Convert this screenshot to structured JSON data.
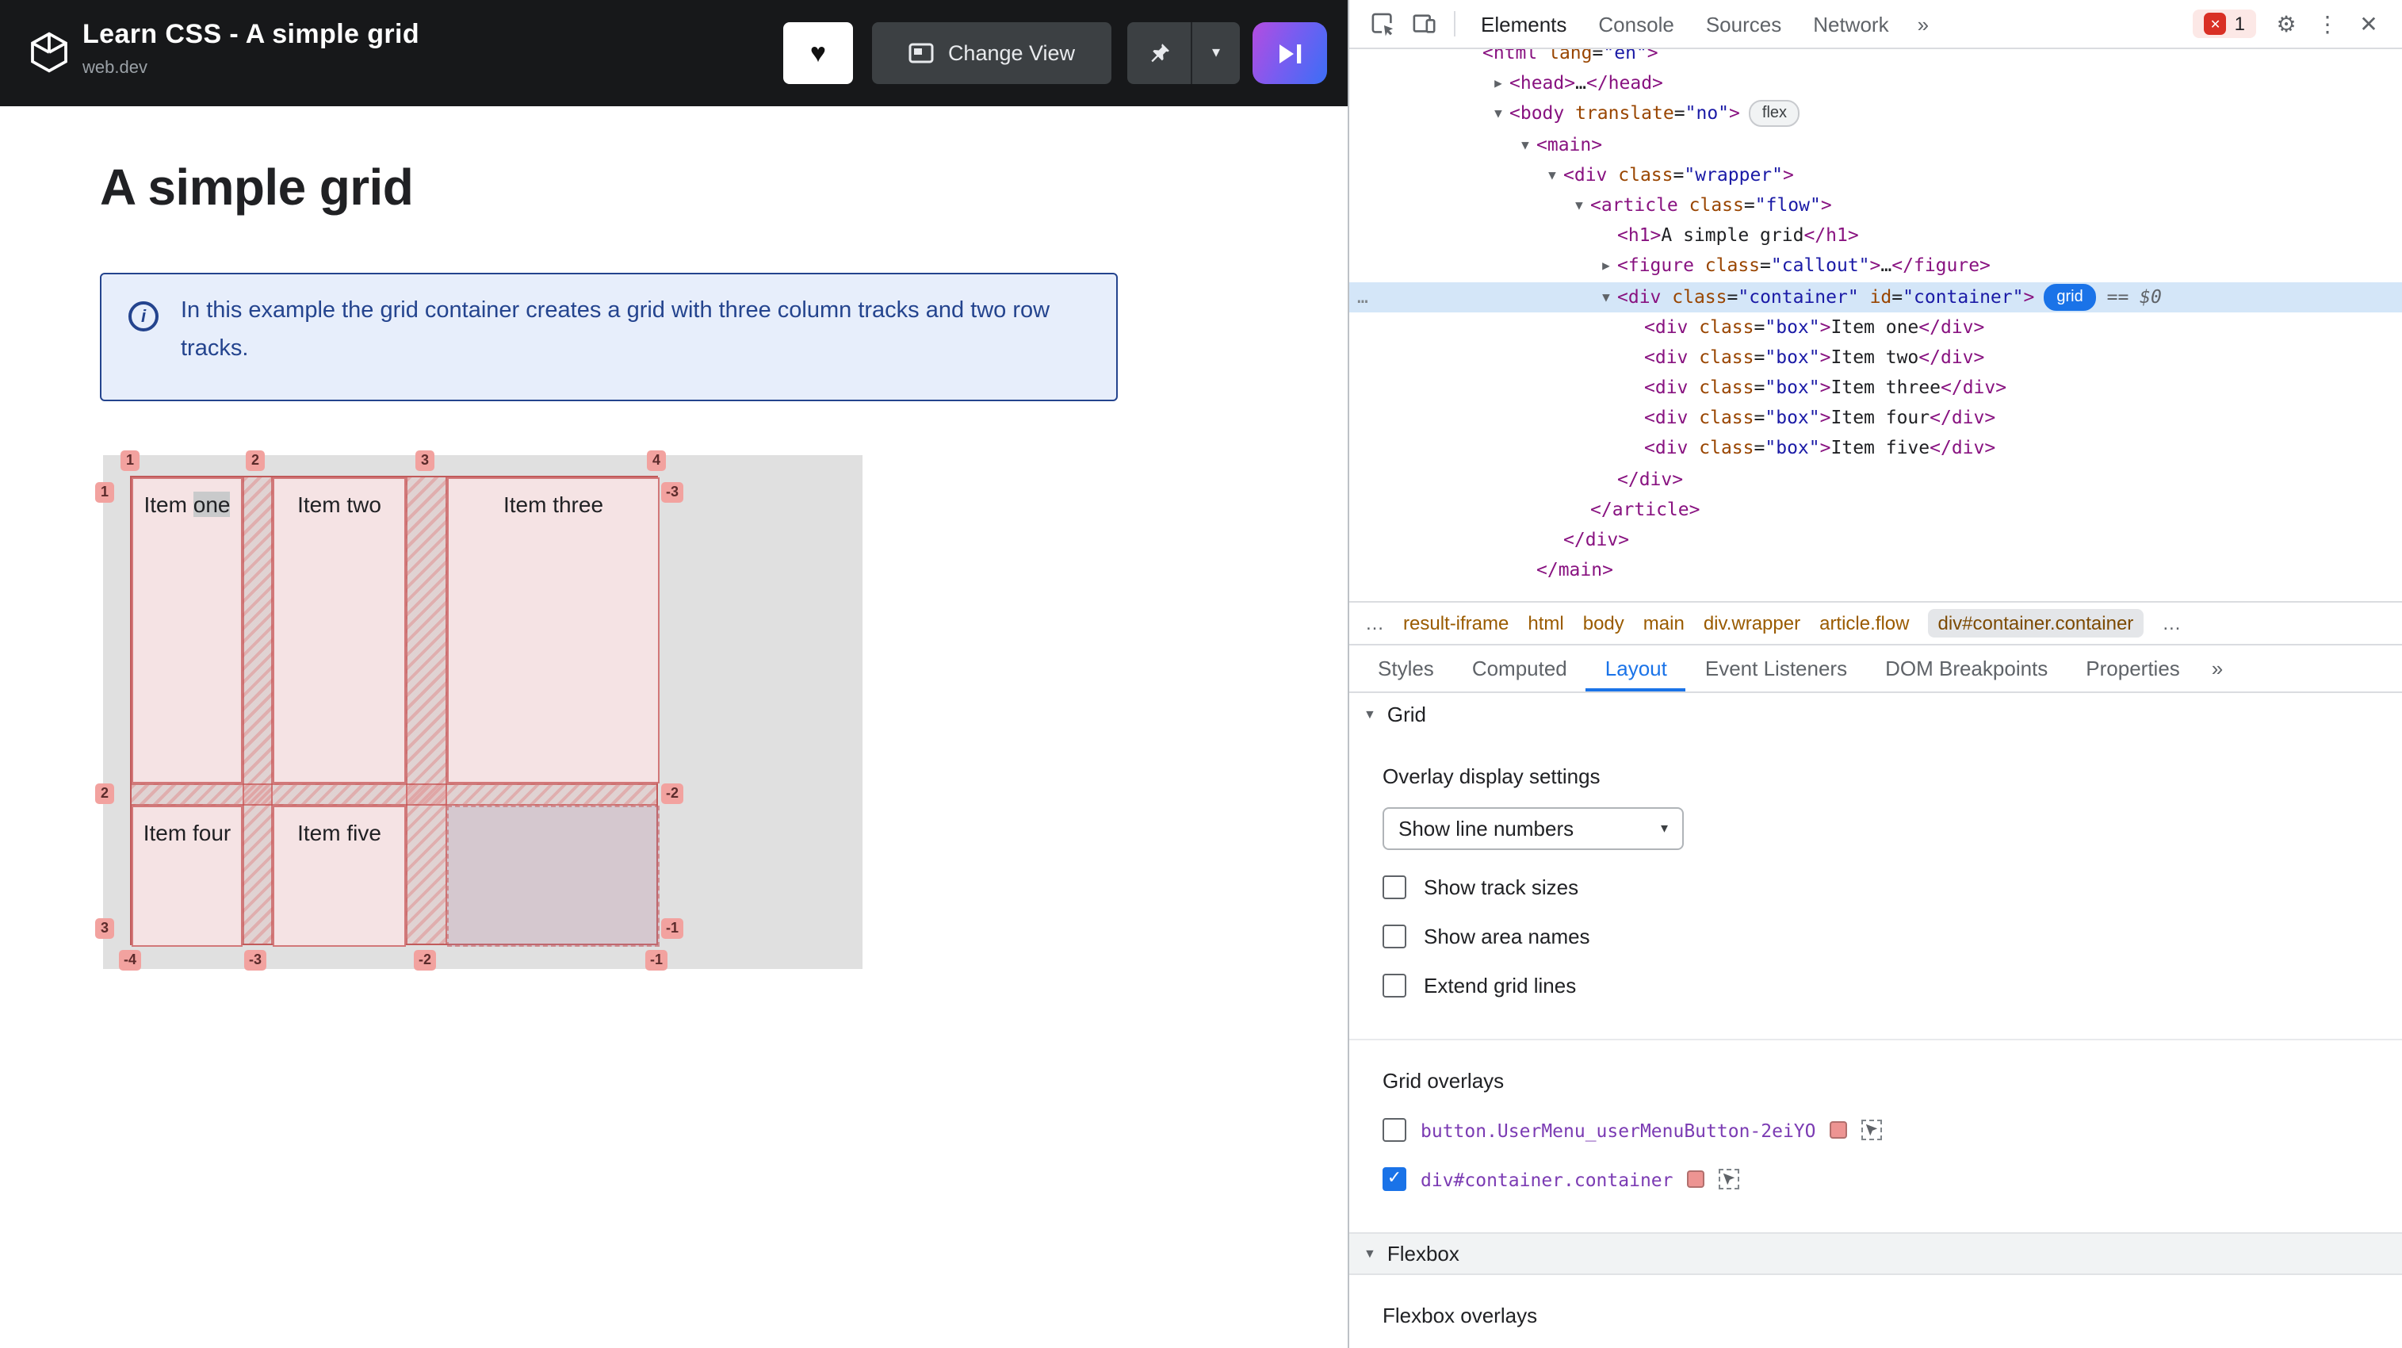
{
  "app": {
    "header": {
      "title": "Learn CSS - A simple grid",
      "subtitle": "web.dev",
      "buttons": {
        "change_view": "Change View"
      }
    },
    "content": {
      "heading": "A simple grid",
      "callout": "In this example the grid container creates a grid with three column tracks and two row tracks.",
      "grid_demo": {
        "items": [
          {
            "text": "Item ",
            "highlight": "one"
          },
          {
            "text": "Item two"
          },
          {
            "text": "Item three"
          },
          {
            "text": "Item four"
          },
          {
            "text": "Item five"
          }
        ],
        "line_numbers": {
          "top": [
            "1",
            "2",
            "3",
            "4"
          ],
          "left": [
            "1",
            "2",
            "3"
          ],
          "right": [
            "-3",
            "-2",
            "-1"
          ],
          "bottom": [
            "-4",
            "-3",
            "-2",
            "-1"
          ]
        }
      }
    }
  },
  "devtools": {
    "toolbar": {
      "tabs": [
        "Elements",
        "Console",
        "Sources",
        "Network"
      ],
      "more": "»",
      "error_count": "1"
    },
    "dom_tree": [
      {
        "indent": 0,
        "arrow": "",
        "tokens": [
          [
            "tag",
            "<html"
          ],
          [
            "attr",
            " lang"
          ],
          [
            "txt",
            "="
          ],
          [
            "val",
            "\"en\""
          ],
          [
            "tag",
            ">"
          ]
        ]
      },
      {
        "indent": 1,
        "arrow": "right",
        "tokens": [
          [
            "tag",
            "<head>"
          ],
          [
            "txt",
            "…"
          ],
          [
            "tag",
            "</head>"
          ]
        ]
      },
      {
        "indent": 1,
        "arrow": "down",
        "tokens": [
          [
            "tag",
            "<body"
          ],
          [
            "attr",
            " translate"
          ],
          [
            "txt",
            "="
          ],
          [
            "val",
            "\"no\""
          ],
          [
            "tag",
            ">"
          ],
          [
            "flex",
            "flex"
          ]
        ]
      },
      {
        "indent": 2,
        "arrow": "down",
        "tokens": [
          [
            "tag",
            "<main>"
          ]
        ]
      },
      {
        "indent": 3,
        "arrow": "down",
        "tokens": [
          [
            "tag",
            "<div"
          ],
          [
            "attr",
            " class"
          ],
          [
            "txt",
            "="
          ],
          [
            "val",
            "\"wrapper\""
          ],
          [
            "tag",
            ">"
          ]
        ]
      },
      {
        "indent": 4,
        "arrow": "down",
        "tokens": [
          [
            "tag",
            "<article"
          ],
          [
            "attr",
            " class"
          ],
          [
            "txt",
            "="
          ],
          [
            "val",
            "\"flow\""
          ],
          [
            "tag",
            ">"
          ]
        ]
      },
      {
        "indent": 5,
        "arrow": "",
        "tokens": [
          [
            "tag",
            "<h1>"
          ],
          [
            "txt",
            "A simple grid"
          ],
          [
            "tag",
            "</h1>"
          ]
        ]
      },
      {
        "indent": 5,
        "arrow": "right",
        "tokens": [
          [
            "tag",
            "<figure"
          ],
          [
            "attr",
            " class"
          ],
          [
            "txt",
            "="
          ],
          [
            "val",
            "\"callout\""
          ],
          [
            "tag",
            ">"
          ],
          [
            "txt",
            "…"
          ],
          [
            "tag",
            "</figure>"
          ]
        ]
      },
      {
        "indent": 5,
        "arrow": "down",
        "sel": true,
        "gutter": "…",
        "tokens": [
          [
            "tag",
            "<div"
          ],
          [
            "attr",
            " class"
          ],
          [
            "txt",
            "="
          ],
          [
            "val",
            "\"container\""
          ],
          [
            "attr",
            " id"
          ],
          [
            "txt",
            "="
          ],
          [
            "val",
            "\"container\""
          ],
          [
            "tag",
            ">"
          ],
          [
            "grid",
            "grid"
          ],
          [
            "gray",
            " == $0"
          ]
        ]
      },
      {
        "indent": 6,
        "arrow": "",
        "tokens": [
          [
            "tag",
            "<div"
          ],
          [
            "attr",
            " class"
          ],
          [
            "txt",
            "="
          ],
          [
            "val",
            "\"box\""
          ],
          [
            "tag",
            ">"
          ],
          [
            "txt",
            "Item one"
          ],
          [
            "tag",
            "</div>"
          ]
        ]
      },
      {
        "indent": 6,
        "arrow": "",
        "tokens": [
          [
            "tag",
            "<div"
          ],
          [
            "attr",
            " class"
          ],
          [
            "txt",
            "="
          ],
          [
            "val",
            "\"box\""
          ],
          [
            "tag",
            ">"
          ],
          [
            "txt",
            "Item two"
          ],
          [
            "tag",
            "</div>"
          ]
        ]
      },
      {
        "indent": 6,
        "arrow": "",
        "tokens": [
          [
            "tag",
            "<div"
          ],
          [
            "attr",
            " class"
          ],
          [
            "txt",
            "="
          ],
          [
            "val",
            "\"box\""
          ],
          [
            "tag",
            ">"
          ],
          [
            "txt",
            "Item three"
          ],
          [
            "tag",
            "</div>"
          ]
        ]
      },
      {
        "indent": 6,
        "arrow": "",
        "tokens": [
          [
            "tag",
            "<div"
          ],
          [
            "attr",
            " class"
          ],
          [
            "txt",
            "="
          ],
          [
            "val",
            "\"box\""
          ],
          [
            "tag",
            ">"
          ],
          [
            "txt",
            "Item four"
          ],
          [
            "tag",
            "</div>"
          ]
        ]
      },
      {
        "indent": 6,
        "arrow": "",
        "tokens": [
          [
            "tag",
            "<div"
          ],
          [
            "attr",
            " class"
          ],
          [
            "txt",
            "="
          ],
          [
            "val",
            "\"box\""
          ],
          [
            "tag",
            ">"
          ],
          [
            "txt",
            "Item five"
          ],
          [
            "tag",
            "</div>"
          ]
        ]
      },
      {
        "indent": 5,
        "arrow": "",
        "tokens": [
          [
            "tag",
            "</div>"
          ]
        ]
      },
      {
        "indent": 4,
        "arrow": "",
        "tokens": [
          [
            "tag",
            "</article>"
          ]
        ]
      },
      {
        "indent": 3,
        "arrow": "",
        "tokens": [
          [
            "tag",
            "</div>"
          ]
        ]
      },
      {
        "indent": 2,
        "arrow": "",
        "tokens": [
          [
            "tag",
            "</main>"
          ]
        ]
      }
    ],
    "breadcrumbs": {
      "overflow_left": "…",
      "items": [
        "result-iframe",
        "html",
        "body",
        "main",
        "div.wrapper",
        "article.flow",
        "div#container.container"
      ],
      "active": "div#container.container",
      "overflow_right": "…"
    },
    "panel_tabs": {
      "items": [
        "Styles",
        "Computed",
        "Layout",
        "Event Listeners",
        "DOM Breakpoints",
        "Properties"
      ],
      "active": "Layout",
      "more": "»"
    },
    "layout_pane": {
      "grid_section": "Grid",
      "overlay_display_settings": "Overlay display settings",
      "line_numbers_value": "Show line numbers",
      "display_options": [
        "Show track sizes",
        "Show area names",
        "Extend grid lines"
      ],
      "grid_overlays_label": "Grid overlays",
      "overlays": [
        {
          "label": "button.UserMenu_userMenuButton-2eiYO",
          "checked": false
        },
        {
          "label": "div#container.container",
          "checked": true
        }
      ],
      "flexbox_section": "Flexbox",
      "flexbox_overlays_label": "Flexbox overlays"
    }
  },
  "icons": {
    "heart": "♥",
    "chevron_down": "▾",
    "gear": "⚙",
    "more_vertical": "⋮",
    "close": "✕",
    "error_x": "✕",
    "select_arrow": "▾",
    "check": "✓",
    "tree_collapsed": "▶",
    "tree_expanded": "▼",
    "section_triangle": "▼"
  },
  "colors": {
    "accent_blue": "#1a73e8",
    "error_red": "#d93025",
    "overlay_pink": "#ed9492",
    "selection_blue": "#d4e6f8"
  }
}
